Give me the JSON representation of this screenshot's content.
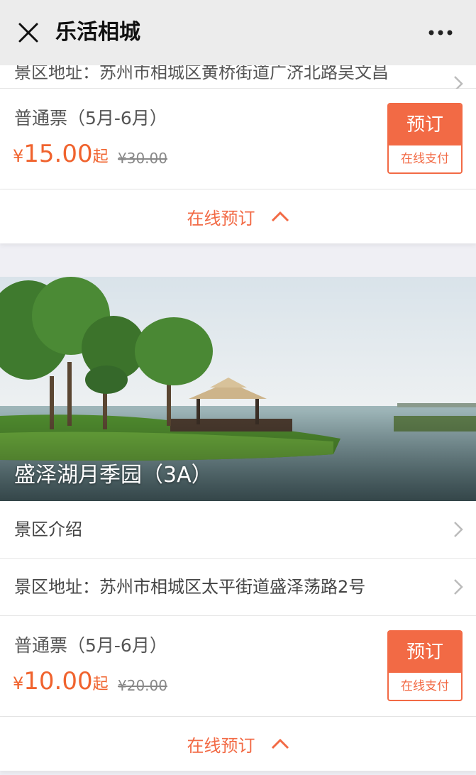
{
  "header": {
    "title": "乐活相城",
    "close_icon": "close-icon",
    "more_icon": "more-dots-icon"
  },
  "prev_spot": {
    "address_partial": "景区地址：苏州市相城区黄桥街道广济北路吴文昌",
    "ticket": {
      "name": "普通票（5月-6月）",
      "currency": "¥",
      "price": "15.00",
      "price_suffix": "起",
      "original_price": "¥30.00",
      "book_label": "预订",
      "pay_label": "在线支付"
    },
    "online_booking_label": "在线预订"
  },
  "spot": {
    "title": "盛泽湖月季园（3A）",
    "intro_label": "景区介绍",
    "address": "景区地址：苏州市相城区太平街道盛泽荡路2号",
    "ticket": {
      "name": "普通票（5月-6月）",
      "currency": "¥",
      "price": "10.00",
      "price_suffix": "起",
      "original_price": "¥20.00",
      "book_label": "预订",
      "pay_label": "在线支付"
    },
    "online_booking_label": "在线预订"
  },
  "colors": {
    "accent": "#f26a45",
    "price": "#f0632e"
  }
}
